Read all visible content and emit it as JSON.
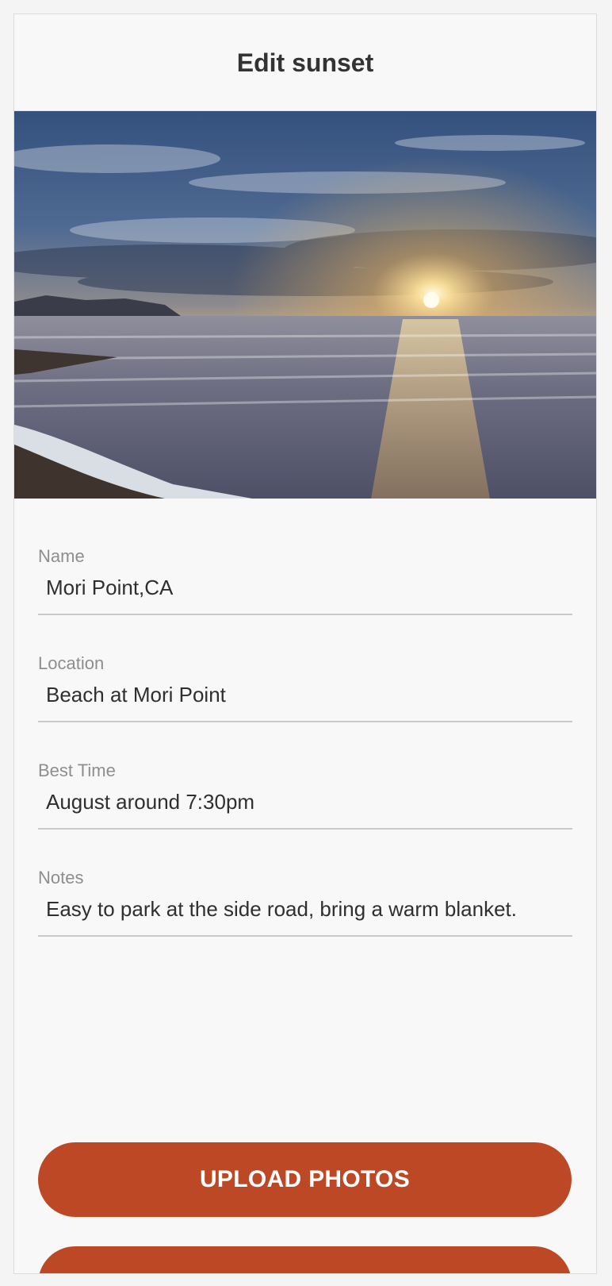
{
  "header": {
    "title": "Edit sunset"
  },
  "photo": {
    "icon": "sunset-photo"
  },
  "form": {
    "fields": [
      {
        "label": "Name",
        "value": "Mori Point,CA"
      },
      {
        "label": "Location",
        "value": "Beach at Mori Point"
      },
      {
        "label": "Best Time",
        "value": "August around 7:30pm"
      },
      {
        "label": "Notes",
        "value": "Easy to park at the side road, bring a warm blanket."
      }
    ]
  },
  "actions": {
    "upload_label": "UPLOAD PHOTOS",
    "second_label": ""
  },
  "colors": {
    "accent": "#bd4826",
    "background": "#f8f8f8"
  }
}
